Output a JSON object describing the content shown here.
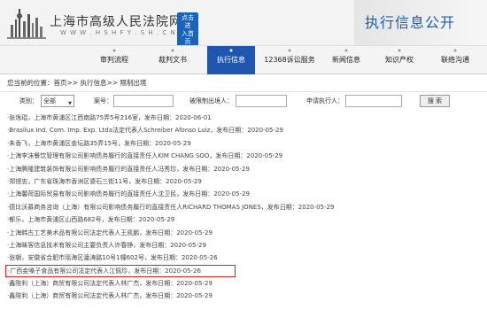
{
  "header": {
    "title": "上海市高级人民法院网",
    "url": "W W W . H S H F Y . S H . C N",
    "badge_line1": "点击进",
    "badge_line2": "入首页",
    "banner": "执行信息公开"
  },
  "nav": [
    "审判流程",
    "裁判文书",
    "执行信息",
    "12368诉讼服务",
    "新闻信息",
    "知识产权",
    "联络沟通"
  ],
  "breadcrumb": "您当前的位置：首页>> 执行信息>> 限制出境",
  "search": {
    "type_label": "类别：",
    "type_value": "全部",
    "case_label": "案号：",
    "person_label": "被限制出境人：",
    "applicant_label": "申请执行人：",
    "button": "搜 索"
  },
  "records": [
    "·张逸琨，上海市黄浦区江西南路75弄5号216室，发布日期：2020-06-01",
    "·Brasilux Ind. Com. Imp. Exp. Ltda法定代表人Schreiber Afonso Luiz，发布日期：2020-05-29",
    "·朱香飞，上海市黄浦区金坛路35弄15号，发布日期：2020-05-29",
    "·上海李沫餐饮管理有限公司影响债务履行的直接责任人KIM CHANG SOO，发布日期：2020-05-29",
    "·上海腾隆建筑装饰有限公司影响债务履行的直接责任人冯秀珍，发布日期：2020-05-29",
    "·郑铿忠，广东省珠海市香洲区婆石三街11号，发布日期：2020-05-29",
    "·上海馨荷国际贸易有限公司影响债务履行的直接责任人沈卫民，发布日期：2020-05-29",
    "·德比沃慕商务咨询（上海）有限公司影响债务履行的直接责任人RICHARD THOMAS JONES，发布日期：2020-05-29",
    "·郁乐，上海市黄浦区山西路682号，发布日期：2020-05-29",
    "·上海韩古工艺美术品有限公司法定代表人王凯鹏，发布日期：2020-05-29",
    "·上海昧客信息技术有限公司主要负责人许春铮，发布日期：2020-05-29",
    "·张朝，安徽省合肥市瑶海区瀍涛路10号1幢602号，发布日期：2020-05-26",
    "·广西金嗓子食品有限公司法定代表人江佩珍，发布日期：2020-05-26",
    "·鑫陛利（上海）商贸有限公司法定代表人林广杰，发布日期：2020-05-29",
    "·鑫陛利（上海）商贸有限公司法定代表人林广杰，发布日期：2020-05-29"
  ],
  "highlighted_index": 12,
  "colors": {
    "nav_active": "#1f56b0",
    "banner_text": "#1a5fb4",
    "highlight_border": "#e02020"
  }
}
